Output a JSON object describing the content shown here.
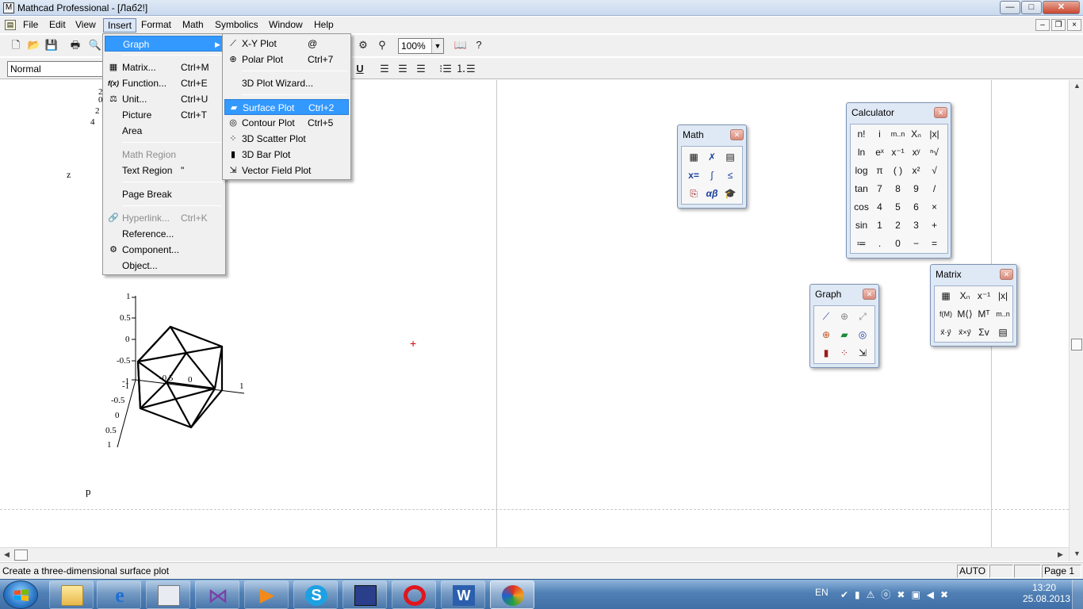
{
  "window": {
    "title": "Mathcad Professional - [Лаб2!]",
    "minimize": "—",
    "maximize": "□",
    "close": "✕",
    "mdi_minimize": "–",
    "mdi_restore": "❐",
    "mdi_close": "×"
  },
  "menubar": [
    "File",
    "Edit",
    "View",
    "Insert",
    "Format",
    "Math",
    "Symbolics",
    "Window",
    "Help"
  ],
  "toolbar": {
    "zoom": "100%",
    "style": "Normal"
  },
  "insert_menu": [
    {
      "label": "Graph",
      "shortcut": "",
      "submenu": true,
      "highlighted": true,
      "icon": ""
    },
    {
      "label": "Matrix...",
      "shortcut": "Ctrl+M",
      "icon": "matrix-icon"
    },
    {
      "label": "Function...",
      "shortcut": "Ctrl+E",
      "icon": "function-icon"
    },
    {
      "label": "Unit...",
      "shortcut": "Ctrl+U",
      "icon": "unit-icon"
    },
    {
      "label": "Picture",
      "shortcut": "Ctrl+T"
    },
    {
      "label": "Area",
      "shortcut": ""
    },
    {
      "label": "Math Region",
      "shortcut": "",
      "disabled": true
    },
    {
      "label": "Text Region",
      "shortcut": "\""
    },
    {
      "label": "Page Break",
      "shortcut": ""
    },
    {
      "label": "Hyperlink...",
      "shortcut": "Ctrl+K",
      "disabled": true,
      "icon": "hyperlink-icon"
    },
    {
      "label": "Reference...",
      "shortcut": ""
    },
    {
      "label": "Component...",
      "shortcut": "",
      "icon": "component-icon"
    },
    {
      "label": "Object...",
      "shortcut": ""
    }
  ],
  "graph_menu": [
    {
      "label": "X-Y Plot",
      "shortcut": "@",
      "icon": "xy-plot-icon"
    },
    {
      "label": "Polar Plot",
      "shortcut": "Ctrl+7",
      "icon": "polar-plot-icon"
    },
    {
      "label": "3D Plot Wizard...",
      "shortcut": ""
    },
    {
      "label": "Surface Plot",
      "shortcut": "Ctrl+2",
      "highlighted": true,
      "icon": "surface-plot-icon"
    },
    {
      "label": "Contour Plot",
      "shortcut": "Ctrl+5",
      "icon": "contour-plot-icon"
    },
    {
      "label": "3D Scatter Plot",
      "shortcut": "",
      "icon": "scatter-plot-icon"
    },
    {
      "label": "3D Bar Plot",
      "shortcut": "",
      "icon": "bar-plot-icon"
    },
    {
      "label": "Vector Field Plot",
      "shortcut": "",
      "icon": "vector-field-icon"
    }
  ],
  "worksheet": {
    "label_z": "z",
    "label_p": "p",
    "partial_ticks": [
      "2",
      "0",
      "2",
      "4"
    ],
    "plot_ticks": {
      "z_axis": [
        "1",
        "0.5",
        "0",
        "-0.5",
        "-1"
      ],
      "x_axis": [
        "-0.5",
        "0",
        "1"
      ],
      "y_axis": [
        "-1",
        "-0.5",
        "0",
        "0.5",
        "1"
      ]
    }
  },
  "palettes": {
    "math": {
      "title": "Math"
    },
    "calculator": {
      "title": "Calculator",
      "keys": [
        [
          "n!",
          "i",
          "m..n",
          "Xₙ",
          "|x|"
        ],
        [
          "ln",
          "eˣ",
          "x⁻¹",
          "xʸ",
          "ⁿ√"
        ],
        [
          "log",
          "π",
          "( )",
          "x²",
          "√"
        ],
        [
          "tan",
          "7",
          "8",
          "9",
          "/"
        ],
        [
          "cos",
          "4",
          "5",
          "6",
          "×"
        ],
        [
          "sin",
          "1",
          "2",
          "3",
          "+"
        ],
        [
          "≔",
          ".",
          "0",
          "−",
          "="
        ]
      ]
    },
    "graph": {
      "title": "Graph"
    },
    "matrix": {
      "title": "Matrix",
      "keys": [
        [
          "▦",
          "Xₙ",
          "x⁻¹",
          "|x|"
        ],
        [
          "f(M)",
          "M⟨⟩",
          "Mᵀ",
          "m..n"
        ],
        [
          "x⃗·y⃗",
          "x⃗×y⃗",
          "Σv",
          "▤"
        ]
      ]
    }
  },
  "statusbar": {
    "message": "Create a three-dimensional surface plot",
    "mode": "AUTO",
    "page": "Page 1"
  },
  "taskbar": {
    "language": "EN",
    "time": "13:20",
    "date": "25.08.2013"
  }
}
